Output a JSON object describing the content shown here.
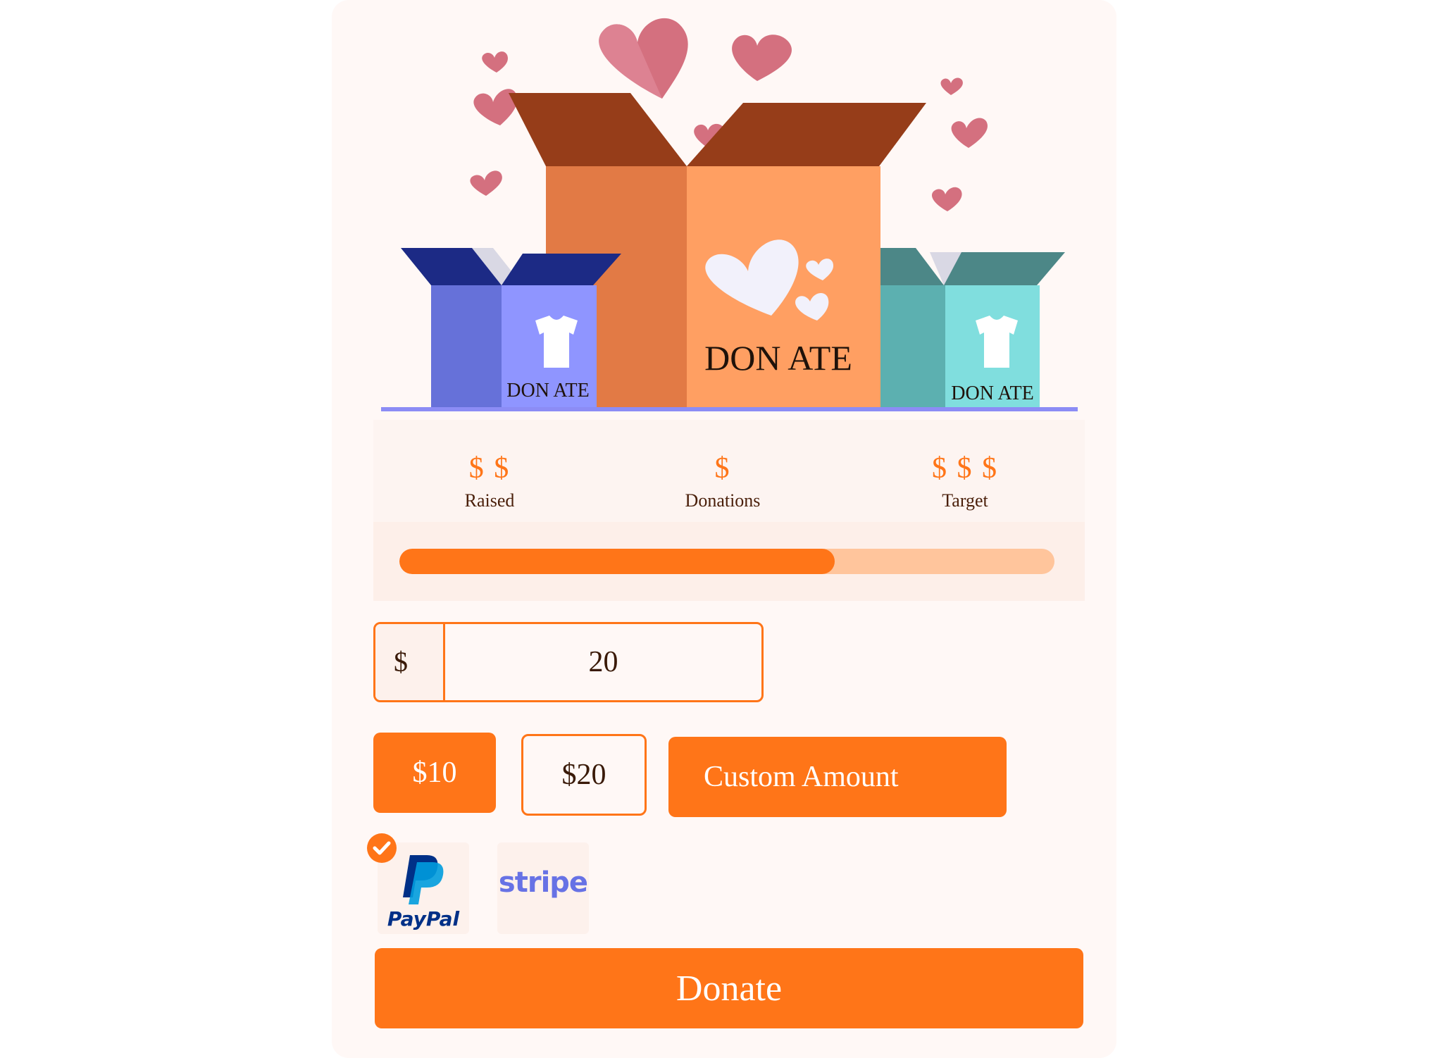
{
  "hero": {
    "box_label_main": "DON ATE",
    "box_label_left": "DON ATE",
    "box_label_right": "DON ATE"
  },
  "stats": {
    "raised": {
      "value": "$ $",
      "label": "Raised"
    },
    "donations": {
      "value": "$",
      "label": "Donations"
    },
    "target": {
      "value": "$ $ $",
      "label": "Target"
    }
  },
  "progress": {
    "percent": 66.5
  },
  "amount": {
    "prefix": "$",
    "value": "20"
  },
  "presets": {
    "p10": "$10",
    "p20": "$20",
    "custom": "Custom Amount"
  },
  "payment": {
    "paypal_label": "PayPal",
    "stripe_label": "stripe",
    "selected": "paypal"
  },
  "donate_label": "Donate",
  "colors": {
    "accent": "#ff7518",
    "accent_light": "#ffc59c",
    "card_bg": "#fff8f6",
    "text_dark": "#4a1f0a"
  }
}
